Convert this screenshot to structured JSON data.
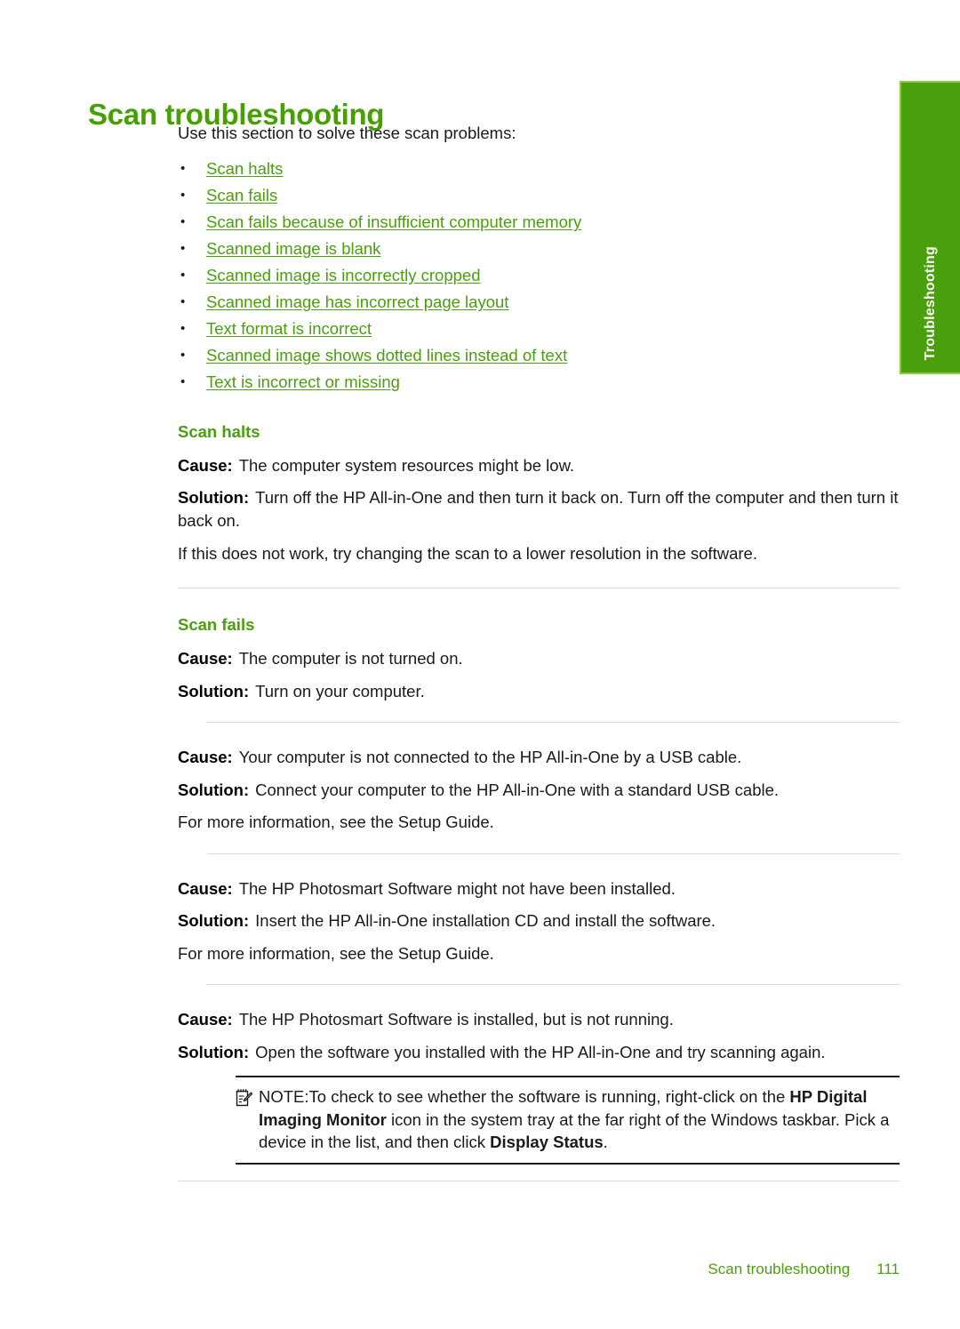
{
  "side_tab": {
    "label": "Troubleshooting",
    "background": "#4aa00c",
    "text_color": "#ffffff"
  },
  "page": {
    "title": "Scan troubleshooting",
    "title_color": "#45a000",
    "intro": "Use this section to solve these scan problems:",
    "link_color": "#4aa00c"
  },
  "toc": [
    {
      "label": "Scan halts"
    },
    {
      "label": "Scan fails"
    },
    {
      "label": "Scan fails because of insufficient computer memory"
    },
    {
      "label": "Scanned image is blank"
    },
    {
      "label": "Scanned image is incorrectly cropped"
    },
    {
      "label": "Scanned image has incorrect page layout"
    },
    {
      "label": "Text format is incorrect"
    },
    {
      "label": "Scanned image shows dotted lines instead of text"
    },
    {
      "label": "Text is incorrect or missing"
    }
  ],
  "sections": [
    {
      "heading": "Scan halts",
      "blocks": [
        {
          "cause_label": "Cause:",
          "cause_text": "The computer system resources might be low.",
          "solution_label": "Solution:",
          "solution_text": "Turn off the HP All-in-One and then turn it back on. Turn off the computer and then turn it back on.",
          "extra_text": "If this does not work, try changing the scan to a lower resolution in the software."
        }
      ]
    },
    {
      "heading": "Scan fails",
      "blocks": [
        {
          "cause_label": "Cause:",
          "cause_text": "The computer is not turned on.",
          "solution_label": "Solution:",
          "solution_text": "Turn on your computer."
        },
        {
          "cause_label": "Cause:",
          "cause_text": "Your computer is not connected to the HP All-in-One by a USB cable.",
          "solution_label": "Solution:",
          "solution_text": "Connect your computer to the HP All-in-One with a standard USB cable.",
          "extra_text": "For more information, see the Setup Guide."
        },
        {
          "cause_label": "Cause:",
          "cause_text": "The HP Photosmart Software might not have been installed.",
          "solution_label": "Solution:",
          "solution_text": "Insert the HP All-in-One installation CD and install the software.",
          "extra_text": "For more information, see the Setup Guide."
        },
        {
          "cause_label": "Cause:",
          "cause_text": "The HP Photosmart Software is installed, but is not running.",
          "solution_label": "Solution:",
          "solution_text": "Open the software you installed with the HP All-in-One and try scanning again."
        }
      ]
    }
  ],
  "note": {
    "icon": "notepad-pencil-icon",
    "label": "NOTE:",
    "text_part1": "To check to see whether the software is running, right-click on the ",
    "bold1": "HP Digital Imaging Monitor",
    "text_part2": " icon in the system tray at the far right of the Windows taskbar. Pick a device in the list, and then click ",
    "bold2": "Display Status",
    "text_part3": "."
  },
  "footer": {
    "title": "Scan troubleshooting",
    "page_number": "111",
    "color": "#4aa00c"
  }
}
